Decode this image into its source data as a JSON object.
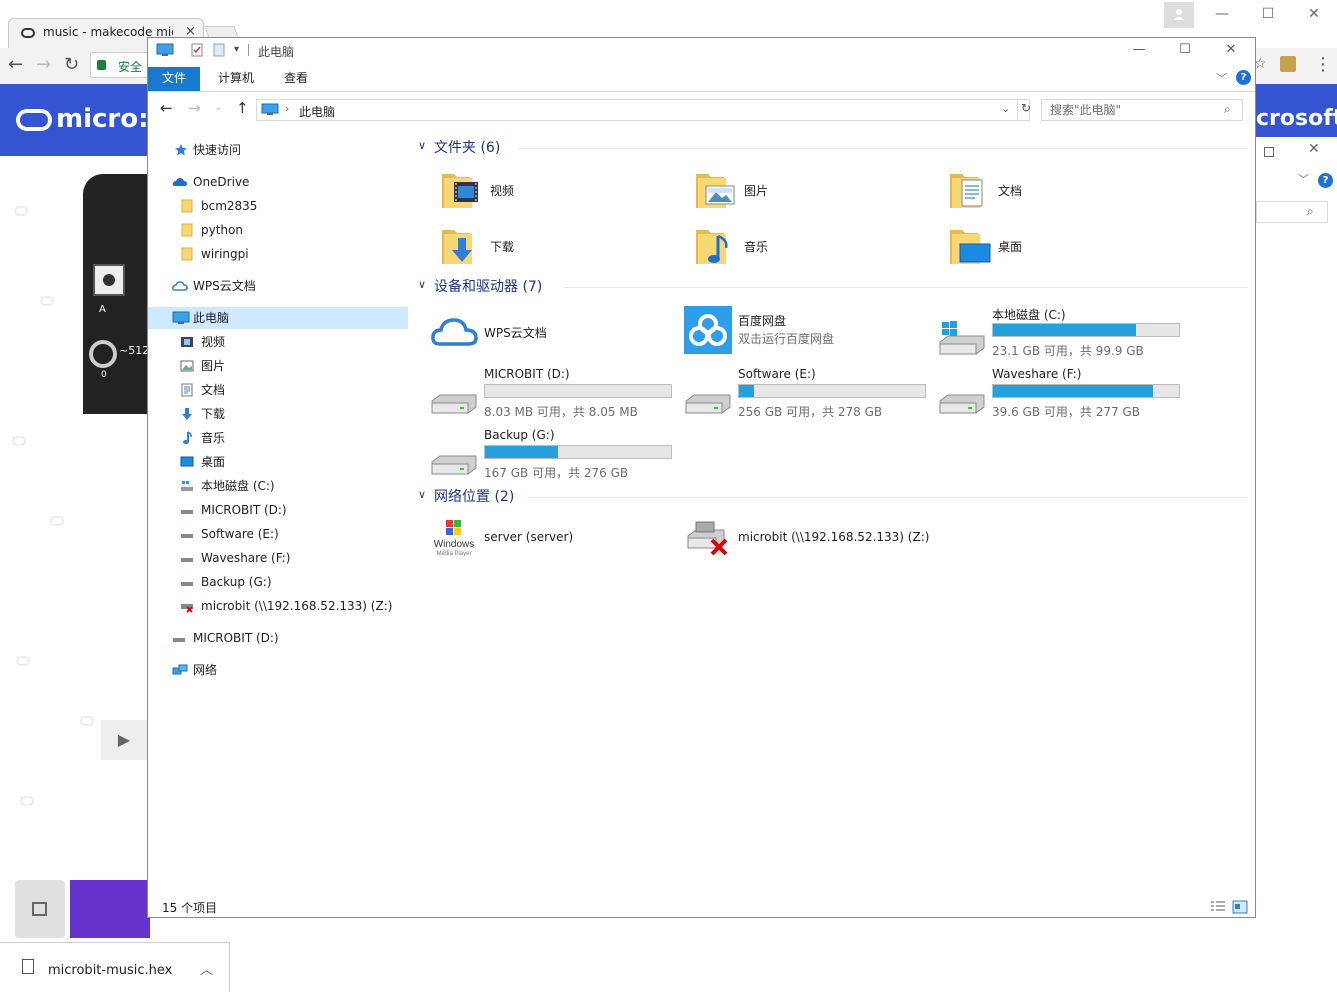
{
  "chrome": {
    "tab_title": "music - makecode mic",
    "tab_close": "×",
    "omnibox_secure": "安全",
    "brand_left": "micro:b",
    "brand_right": "crosoft",
    "board_label": "~512",
    "board_pin": "0",
    "board_a": "A",
    "download_file": "microbit-music.hex"
  },
  "explorer": {
    "window_title": "此电脑",
    "ribbon_tabs": [
      "文件",
      "计算机",
      "查看"
    ],
    "address_path": "此电脑",
    "search_placeholder": "搜索\"此电脑\"",
    "nav": {
      "quick_access": "快速访问",
      "onedrive": "OneDrive",
      "onedrive_items": [
        "bcm2835",
        "python",
        "wiringpi"
      ],
      "wps": "WPS云文档",
      "this_pc": "此电脑",
      "this_pc_items": [
        "视频",
        "图片",
        "文档",
        "下载",
        "音乐",
        "桌面",
        "本地磁盘 (C:)",
        "MICROBIT (D:)",
        "Software (E:)",
        "Waveshare (F:)",
        "Backup (G:)",
        "microbit (\\\\192.168.52.133) (Z:)"
      ],
      "microbit_root": "MICROBIT (D:)",
      "network": "网络"
    },
    "groups": {
      "folders": "文件夹 (6)",
      "devices": "设备和驱动器 (7)",
      "network": "网络位置 (2)"
    },
    "folders": [
      "视频",
      "图片",
      "文档",
      "下载",
      "音乐",
      "桌面"
    ],
    "wps_cloud": "WPS云文档",
    "baidu": {
      "name": "百度网盘",
      "sub": "双击运行百度网盘"
    },
    "drives": [
      {
        "name": "本地磁盘 (C:)",
        "free": "23.1 GB 可用，共 99.9 GB",
        "used_fraction": 0.77
      },
      {
        "name": "MICROBIT (D:)",
        "free": "8.03 MB 可用，共 8.05 MB",
        "used_fraction": 0.0
      },
      {
        "name": "Software (E:)",
        "free": "256 GB 可用，共 278 GB",
        "used_fraction": 0.08
      },
      {
        "name": "Waveshare (F:)",
        "free": "39.6 GB 可用，共 277 GB",
        "used_fraction": 0.86
      },
      {
        "name": "Backup (G:)",
        "free": "167 GB 可用，共 276 GB",
        "used_fraction": 0.39
      }
    ],
    "network_locations": [
      "server (server)",
      "microbit (\\\\192.168.52.133) (Z:)"
    ],
    "status_count": "15 个项目",
    "accent": "#1979ca",
    "bar_color": "#26a0da",
    "group_color": "#1e3287"
  }
}
